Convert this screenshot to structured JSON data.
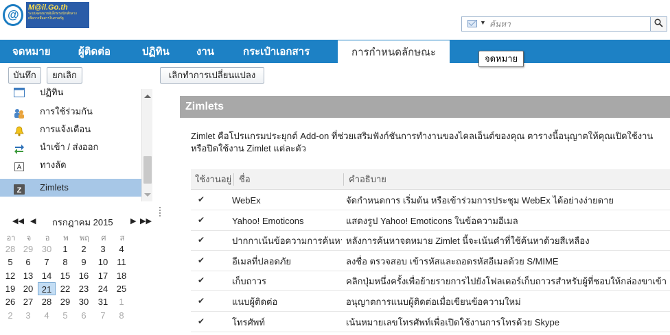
{
  "app": {
    "logo_title": "M@il.Go.th",
    "logo_sub_1": "ระบบจดหมายอิเล็กทรอนิกส์กลาง",
    "logo_sub_2": "เพื่อการสื่อสารในภาครัฐ"
  },
  "search": {
    "placeholder": "ค้นหา",
    "type_icon": "envelope-icon",
    "dropdown_glyph": "▼",
    "button_glyph": "🔍"
  },
  "tabs": [
    {
      "label": "จดหมาย"
    },
    {
      "label": "ผู้ติดต่อ"
    },
    {
      "label": "ปฏิทิน"
    },
    {
      "label": "งาน"
    },
    {
      "label": "กระเป๋าเอกสาร"
    },
    {
      "label": "การกำหนดลักษณะ",
      "active": true
    }
  ],
  "tooltip": "จดหมาย",
  "toolbar": {
    "save": "บันทึก",
    "cancel": "ยกเลิก",
    "undo_changes": "เลิกทำการเปลี่ยนแปลง"
  },
  "sidebar": {
    "items": [
      {
        "label": "ปฏิทิน",
        "icon": "calendar-icon"
      },
      {
        "label": "การใช้ร่วมกัน",
        "icon": "sharing-icon"
      },
      {
        "label": "การแจ้งเตือน",
        "icon": "bell-icon"
      },
      {
        "label": "นำเข้า / ส่งออก",
        "icon": "import-export-icon"
      },
      {
        "label": "ทางลัด",
        "icon": "shortcut-icon"
      },
      {
        "label": "Zimlets",
        "icon": "zimlet-icon",
        "selected": true
      }
    ]
  },
  "calendar": {
    "title": "กรกฎาคม 2015",
    "prev_year": "◀◀",
    "prev_month": "◀",
    "next_month": "▶",
    "next_year": "▶▶",
    "weekdays": [
      "อา",
      "จ",
      "อ",
      "พ",
      "พฤ",
      "ศ",
      "ส"
    ],
    "weeks": [
      [
        "28",
        "29",
        "30",
        "1",
        "2",
        "3",
        "4"
      ],
      [
        "5",
        "6",
        "7",
        "8",
        "9",
        "10",
        "11"
      ],
      [
        "12",
        "13",
        "14",
        "15",
        "16",
        "17",
        "18"
      ],
      [
        "19",
        "20",
        "21",
        "22",
        "23",
        "24",
        "25"
      ],
      [
        "26",
        "27",
        "28",
        "29",
        "30",
        "31",
        "1"
      ],
      [
        "2",
        "3",
        "4",
        "5",
        "6",
        "7",
        "8"
      ]
    ],
    "today": "21"
  },
  "content": {
    "section_title": "Zimlets",
    "description": "Zimlet คือโปรแกรมประยุกต์ Add-on ที่ช่วยเสริมฟังก์ชันการทำงานของไคลเอ็นต์ของคุณ ตารางนี้อนุญาตให้คุณเปิดใช้งานหรือปิดใช้งาน Zimlet แต่ละตัว",
    "columns": {
      "enabled": "ใช้งานอยู่",
      "name": "ชื่อ",
      "description": "คำอธิบาย"
    },
    "rows": [
      {
        "name": "WebEx",
        "desc": "จัดกำหนดการ เริ่มต้น หรือเข้าร่วมการประชุม WebEx ได้อย่างง่ายดาย",
        "checked": true
      },
      {
        "name": "Yahoo! Emoticons",
        "desc": "แสดงรูป Yahoo! Emoticons ในข้อความอีเมล",
        "checked": true
      },
      {
        "name": "ปากกาเน้นข้อความการค้นหา",
        "desc": "หลังการค้นหาจดหมาย Zimlet นี้จะเน้นคำที่ใช้ค้นหาด้วยสีเหลือง",
        "checked": true
      },
      {
        "name": "อีเมลที่ปลอดภัย",
        "desc": "ลงชื่อ ตรวจสอบ เข้ารหัสและถอดรหัสอีเมลด้วย S/MIME",
        "checked": true
      },
      {
        "name": "เก็บถาวร",
        "desc": "คลิกปุ่มหนึ่งครั้งเพื่อย้ายรายการไปยังโฟลเดอร์เก็บถาวรสำหรับผู้ที่ชอบให้กล่องขาเข้า",
        "checked": true
      },
      {
        "name": "แนบผู้ติดต่อ",
        "desc": "อนุญาตการแนบผู้ติดต่อเมื่อเขียนข้อความใหม่",
        "checked": true
      },
      {
        "name": "โทรศัพท์",
        "desc": "เน้นหมายเลขโทรศัพท์เพื่อเปิดใช้งานการโทรด้วย Skype",
        "checked": true
      }
    ]
  },
  "colors": {
    "tab_bar": "#1d81c5",
    "selected_item": "#a7c7e7",
    "section_header": "#a8a8a8"
  }
}
